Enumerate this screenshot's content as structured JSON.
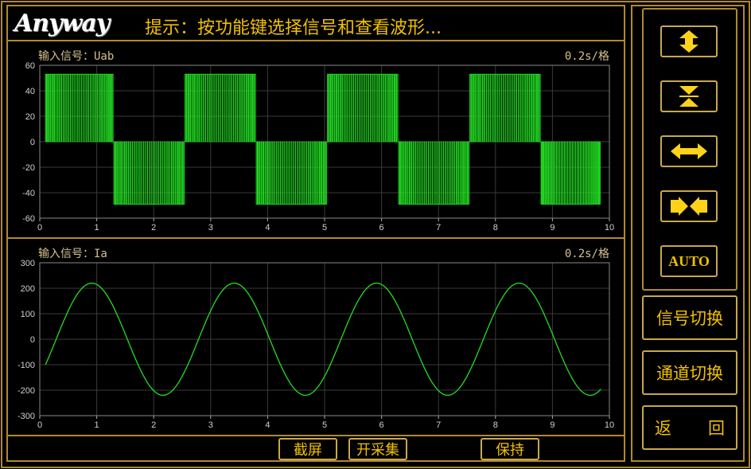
{
  "header": {
    "logo": "Anyway",
    "hint": "提示：按功能键选择信号和查看波形..."
  },
  "plots": [
    {
      "signal_label": "输入信号：Uab",
      "timebase": "0.2s/格",
      "y_ticks": [
        "60",
        "40",
        "20",
        "0",
        "-20",
        "-40",
        "-60"
      ],
      "x_ticks": [
        "0",
        "1",
        "2",
        "3",
        "4",
        "5",
        "6",
        "7",
        "8",
        "9",
        "10"
      ]
    },
    {
      "signal_label": "输入信号：Ia",
      "timebase": "0.2s/格",
      "y_ticks": [
        "300",
        "200",
        "100",
        "0",
        "-100",
        "-200",
        "-300"
      ],
      "x_ticks": [
        "0",
        "1",
        "2",
        "3",
        "4",
        "5",
        "6",
        "7",
        "8",
        "9",
        "10"
      ]
    }
  ],
  "chart_data": [
    {
      "type": "line",
      "series": [
        {
          "name": "Uab",
          "description_values": {
            "amplitude_high": 53,
            "amplitude_low": -49,
            "switching": "PWM"
          }
        }
      ],
      "xlim": [
        0,
        10
      ],
      "ylim": [
        -60,
        60
      ],
      "segments": [
        {
          "x_start": 0.1,
          "x_end": 1.3,
          "level": "high"
        },
        {
          "x_start": 1.3,
          "x_end": 2.55,
          "level": "low"
        },
        {
          "x_start": 2.55,
          "x_end": 3.8,
          "level": "high"
        },
        {
          "x_start": 3.8,
          "x_end": 5.05,
          "level": "low"
        },
        {
          "x_start": 5.05,
          "x_end": 6.3,
          "level": "high"
        },
        {
          "x_start": 6.3,
          "x_end": 7.55,
          "level": "low"
        },
        {
          "x_start": 7.55,
          "x_end": 8.8,
          "level": "high"
        },
        {
          "x_start": 8.8,
          "x_end": 9.85,
          "level": "low"
        }
      ],
      "grid": true
    },
    {
      "type": "line",
      "series": [
        {
          "name": "Ia",
          "amplitude": 220,
          "start_value": -100,
          "x_start": 0.1,
          "x_end": 9.85,
          "period": 2.5
        }
      ],
      "xlim": [
        0,
        10
      ],
      "ylim": [
        -300,
        300
      ],
      "grid": true
    }
  ],
  "bottom_bar": {
    "screenshot": "截屏",
    "start_acq": "开采集",
    "hold": "保持"
  },
  "side_panel": {
    "auto": "AUTO",
    "signal_switch": "信号切换",
    "channel_switch": "通道切换",
    "back_left": "返",
    "back_right": "回"
  },
  "colors": {
    "frame": "#b08a2a",
    "text": "#f0c000",
    "trace": "#22dd22",
    "grid": "#3a3a3a",
    "icon": "#ffd21a"
  }
}
